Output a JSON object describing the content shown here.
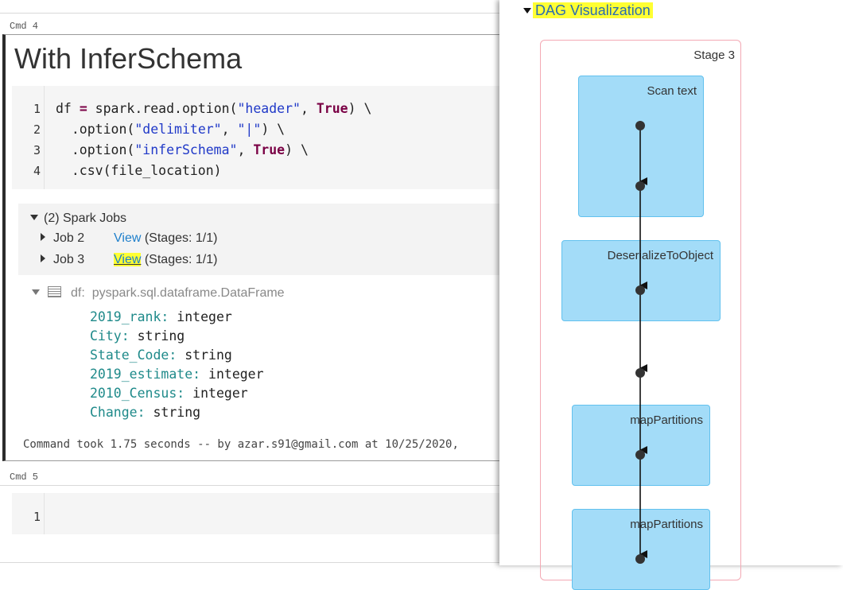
{
  "notebook": {
    "cmd4_label": "Cmd 4",
    "cell_title": "With InferSchema",
    "code_lines": [
      {
        "n": "1",
        "tokens": [
          {
            "t": "df ",
            "c": ""
          },
          {
            "t": "=",
            "c": "kw"
          },
          {
            "t": " spark.read.option(",
            "c": ""
          },
          {
            "t": "\"header\"",
            "c": "str"
          },
          {
            "t": ", ",
            "c": ""
          },
          {
            "t": "True",
            "c": "kw"
          },
          {
            "t": ") \\",
            "c": ""
          }
        ]
      },
      {
        "n": "2",
        "tokens": [
          {
            "t": "  .option(",
            "c": ""
          },
          {
            "t": "\"delimiter\"",
            "c": "str"
          },
          {
            "t": ", ",
            "c": ""
          },
          {
            "t": "\"|\"",
            "c": "str"
          },
          {
            "t": ") \\",
            "c": ""
          }
        ]
      },
      {
        "n": "3",
        "tokens": [
          {
            "t": "  .option(",
            "c": ""
          },
          {
            "t": "\"inferSchema\"",
            "c": "str"
          },
          {
            "t": ", ",
            "c": ""
          },
          {
            "t": "True",
            "c": "kw"
          },
          {
            "t": ") \\",
            "c": ""
          }
        ]
      },
      {
        "n": "4",
        "tokens": [
          {
            "t": "  .csv(file_location)",
            "c": ""
          }
        ]
      }
    ],
    "spark_jobs": {
      "header": "(2) Spark Jobs",
      "jobs": [
        {
          "name": "Job 2",
          "view": "View",
          "stages": "(Stages: 1/1)"
        },
        {
          "name": "Job 3",
          "view": "View",
          "stages": "(Stages: 1/1)"
        }
      ]
    },
    "schema": {
      "var": "df:",
      "type": "pyspark.sql.dataframe.DataFrame",
      "fields": [
        {
          "name": "2019_rank:",
          "type": "integer"
        },
        {
          "name": "City:",
          "type": "string"
        },
        {
          "name": "State_Code:",
          "type": "string"
        },
        {
          "name": "2019_estimate:",
          "type": "integer"
        },
        {
          "name": "2010_Census:",
          "type": "integer"
        },
        {
          "name": "Change:",
          "type": "string"
        }
      ]
    },
    "command_took": "Command took 1.75 seconds -- by azar.s91@gmail.com at 10/25/2020,",
    "cmd5_label": "Cmd 5",
    "cmd5_line_no": "1"
  },
  "dag": {
    "title": "DAG Visualization",
    "stage_label": "Stage 3",
    "operators": [
      "Scan text",
      "DeserializeToObject",
      "mapPartitions",
      "mapPartitions"
    ]
  },
  "colors": {
    "highlight": "#ffff33",
    "link": "#1e7fcb",
    "op_fill": "#a3dcf8",
    "op_border": "#62c1ee",
    "stage_border": "#f3a9b4"
  }
}
